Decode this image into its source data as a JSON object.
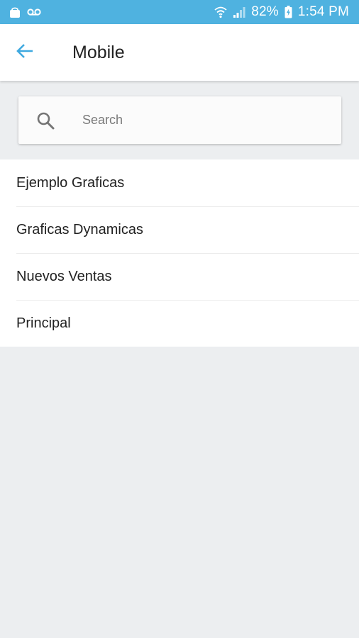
{
  "status_bar": {
    "battery": "82%",
    "time": "1:54 PM",
    "icons": [
      "shopping-bag-icon",
      "voicemail-icon",
      "wifi-icon",
      "signal-icon",
      "battery-charging-icon"
    ]
  },
  "app_bar": {
    "title": "Mobile",
    "back_icon": "arrow-back-icon"
  },
  "search": {
    "placeholder": "Search",
    "value": ""
  },
  "list": {
    "items": [
      {
        "label": "Ejemplo Graficas"
      },
      {
        "label": "Graficas Dynamicas"
      },
      {
        "label": "Nuevos Ventas"
      },
      {
        "label": "Principal"
      }
    ]
  },
  "colors": {
    "status_bar": "#4fb2e0",
    "accent": "#3fa9e0",
    "background": "#eceef0"
  }
}
